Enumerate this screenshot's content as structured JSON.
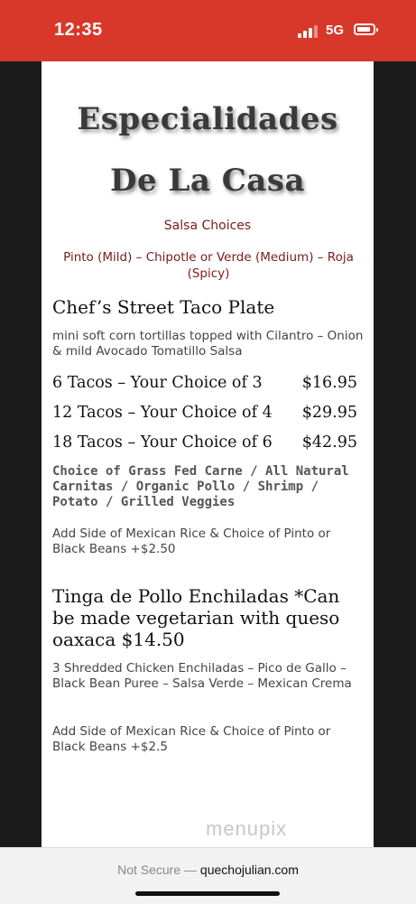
{
  "status_bar": {
    "time": "12:35",
    "network": "5G",
    "background": "#d8382a"
  },
  "menu": {
    "title_line1": "Especialidades",
    "title_line2": "De La Casa",
    "salsa_title": "Salsa Choices",
    "salsa_options": "Pinto (Mild)  –  Chipotle or Verde (Medium)  –  Roja (Spicy)",
    "dish1": {
      "name": "Chef’s Street Taco Plate",
      "description": "mini soft corn tortillas topped with Cilantro – Onion & mild Avocado Tomatillo Salsa",
      "options": [
        {
          "label": "6 Tacos  – Your Choice of 3",
          "price": "$16.95"
        },
        {
          "label": "12 Tacos – Your Choice of 4",
          "price": "$29.95"
        },
        {
          "label": "18 Tacos – Your Choice of 6",
          "price": "$42.95"
        }
      ],
      "choice": "Choice of  Grass Fed Carne / All Natural Carnitas / Organic Pollo  / Shrimp / Potato / Grilled Veggies",
      "side": "Add Side of Mexican Rice & Choice of Pinto or Black Beans +$2.50"
    },
    "dish2": {
      "name": "Tinga de Pollo Enchiladas *Can be made vegetarian with queso oaxaca  $14.50",
      "description": "3 Shredded Chicken Enchiladas – Pico de Gallo – Black Bean Puree – Salsa Verde – Mexican Crema",
      "side": "Add Side of Mexican Rice & Choice of Pinto or Black Beans +$2.5"
    },
    "watermark": "menupix",
    "title_color": "#3a3a3a",
    "salsa_color": "#7b1b1b"
  },
  "browser": {
    "security": "Not Secure —",
    "domain": "quechojulian.com"
  }
}
